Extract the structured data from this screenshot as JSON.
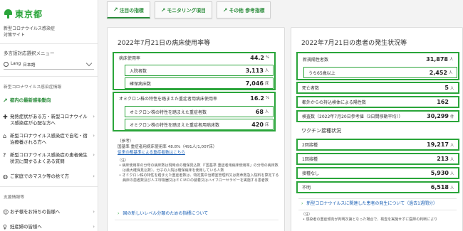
{
  "sidebar": {
    "logo_text": "東京都",
    "site_name_line1": "新型コロナウイルス感染症",
    "site_name_line2": "対策サイト",
    "menu_title": "多言語対応選択メニュー",
    "lang_prefix": "Lang",
    "lang_value": "日本語",
    "section_info": "新型コロナウイルス感染症情報",
    "items": [
      {
        "label": "都内の最新感染動向",
        "icon": "trend-icon",
        "active": true
      },
      {
        "label": "発熱症状がある方・新型コロナウイルス感染症が心配な方へ",
        "icon": "thermometer-icon",
        "active": false
      },
      {
        "label": "新型コロナウイルス感染症で自宅・宿泊療養される方へ",
        "icon": "home-icon",
        "active": false
      },
      {
        "label": "新型コロナウイルス感染症の患者発生状況に関するよくある質問",
        "icon": "question-icon",
        "active": false
      },
      {
        "label": "ご家庭でのマスク等の捨て方",
        "icon": "mask-icon",
        "active": false
      }
    ],
    "section_support": "支援情報等",
    "support_items": [
      {
        "label": "お子様をお持ちの皆様へ",
        "icon": "family-icon"
      },
      {
        "label": "妊産婦の皆様へ",
        "icon": "pregnant-icon"
      }
    ]
  },
  "tabs": [
    {
      "label": "注目の指標",
      "active": true
    },
    {
      "label": "モニタリング項目",
      "active": false
    },
    {
      "label": "その他 参考指標",
      "active": false
    }
  ],
  "bed_card": {
    "title": "2022年7月21日の病床使用率等",
    "rows": [
      {
        "label": "病床使用率",
        "value": "44.2",
        "unit": "%"
      },
      {
        "label": "入院者数",
        "value": "3,113",
        "unit": "人"
      },
      {
        "label": "確保病床数",
        "value": "7,046",
        "unit": "床"
      },
      {
        "label": "オミクロン株の特性を踏まえた重症者用病床使用率",
        "value": "16.2",
        "unit": "%"
      },
      {
        "label": "オミクロン株の特性を踏まえた重症者数",
        "value": "68",
        "unit": "人"
      },
      {
        "label": "オミクロン株の特性を踏まえた重症者用病床数",
        "value": "420",
        "unit": "床"
      }
    ],
    "ref_label": "（参考）",
    "ref_text": "国基準 重症者用病床使用率 48.8%（491人/1,007床）",
    "ref_link": "従来の都基準による重症者数はこちら",
    "notes_label": "（注）",
    "notes": [
      "病床使用率の分母の病床数は現時点の確保見込数（「国基準 重症者用病床使用率」の分母の病床数は最大確保見込数）。分子の入院は確保病床を使用している人数",
      "オミクロン株の特性を踏まえた重症者数は、特定集中治療室管理料又は救命救急入院料を算定する病床の患者数及び人工呼吸器又はＥＣＭＯの装着又はハイフローセラピーを実施する患者数"
    ],
    "link_text": "国の新しいレベル分類のための指標について"
  },
  "patient_card": {
    "title": "2022年7月21日の患者の発生状況等",
    "rows": [
      {
        "label": "新規陽性者数",
        "value": "31,878",
        "unit": "人"
      },
      {
        "label": "うち65歳以上",
        "value": "2,452",
        "unit": "人"
      },
      {
        "label": "死亡者数",
        "value": "5",
        "unit": "人"
      },
      {
        "label": "都外からの持込検体による陽性数",
        "value": "162",
        "unit": ""
      },
      {
        "label": "検査数（2022年7月20日参考値（3日間移動平均））",
        "value": "30,299",
        "unit": "件"
      }
    ],
    "vaccine_title": "ワクチン接種状況",
    "vaccine_rows": [
      {
        "label": "2回接種",
        "value": "19,217",
        "unit": "人"
      },
      {
        "label": "1回接種",
        "value": "213",
        "unit": "人"
      },
      {
        "label": "接種なし",
        "value": "5,930",
        "unit": "人"
      },
      {
        "label": "不明",
        "value": "6,518",
        "unit": "人"
      }
    ],
    "link_text": "新型コロナウイルスに関連した患者の発生について（過去1週間分）",
    "notes_label": "（注）",
    "note_text": "感染者の重症傾向が判明次第となった場合で、検査を実施せずに医師の判断により"
  },
  "colors": {
    "accent": "#2aa53a",
    "tab_text": "#2a8c3a",
    "link": "#1a5fb4"
  }
}
